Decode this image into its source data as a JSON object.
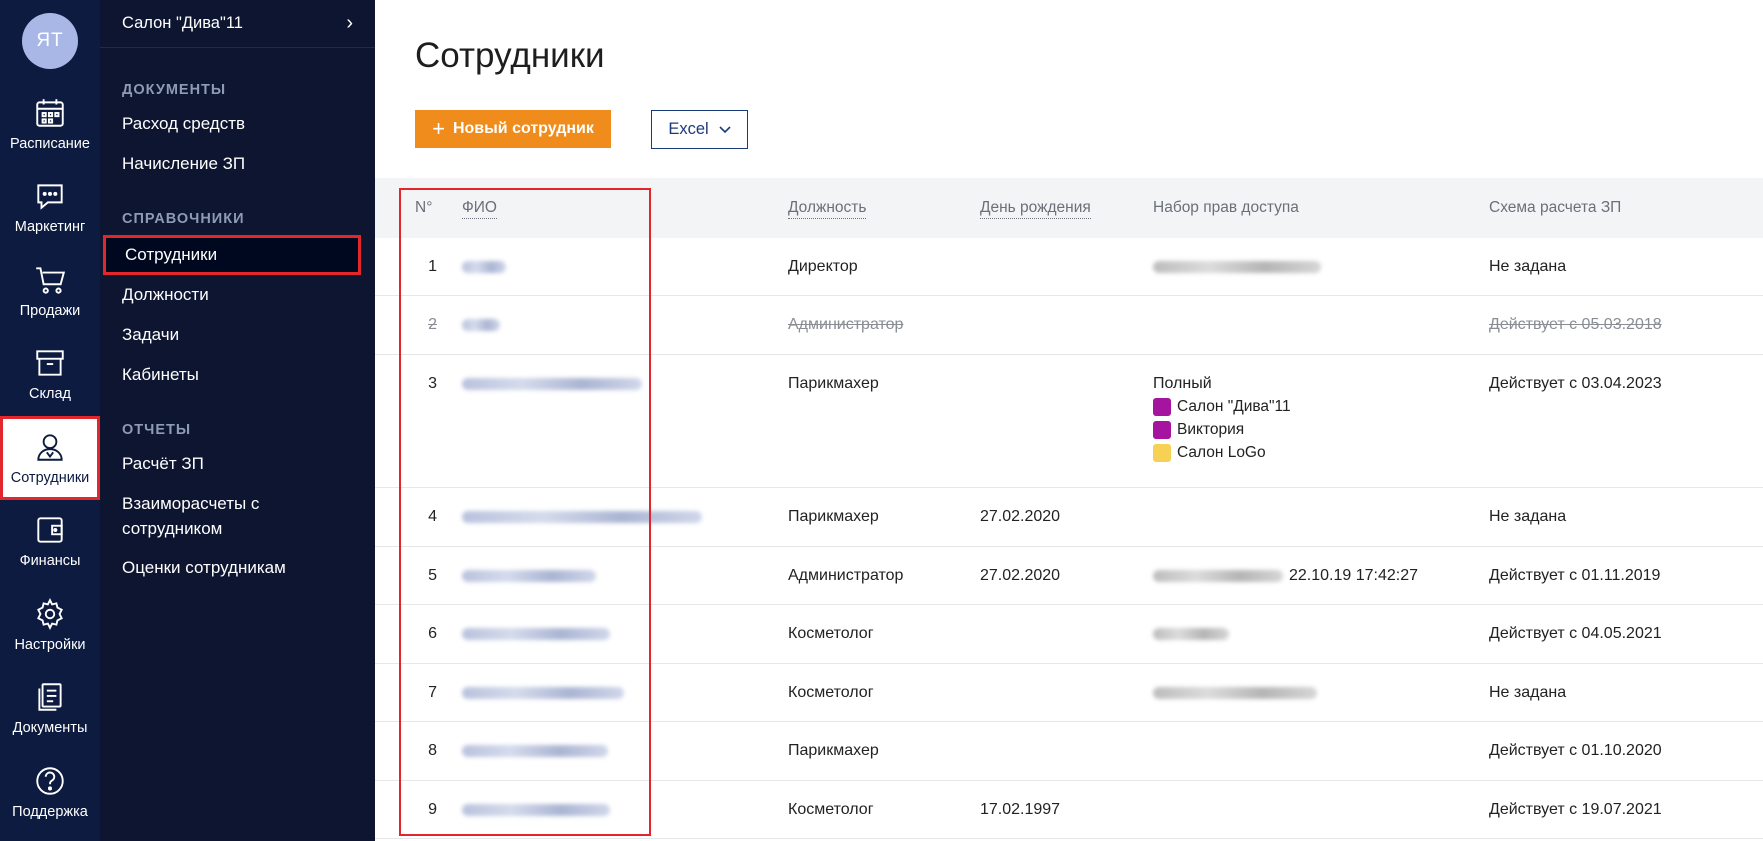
{
  "rail": {
    "avatar": "ЯТ",
    "items": [
      {
        "label": "Расписание",
        "icon": "calendar-icon"
      },
      {
        "label": "Маркетинг",
        "icon": "chat-icon"
      },
      {
        "label": "Продажи",
        "icon": "cart-icon"
      },
      {
        "label": "Склад",
        "icon": "archive-icon"
      },
      {
        "label": "Сотрудники",
        "icon": "user-icon"
      },
      {
        "label": "Финансы",
        "icon": "wallet-icon"
      },
      {
        "label": "Настройки",
        "icon": "gear-icon"
      },
      {
        "label": "Документы",
        "icon": "documents-icon"
      },
      {
        "label": "Поддержка",
        "icon": "help-icon"
      }
    ]
  },
  "menu": {
    "salon": "Салон \"Дива\"11",
    "sections": {
      "docs": "ДОКУМЕНТЫ",
      "refs": "СПРАВОЧНИКИ",
      "reports": "ОТЧЕТЫ"
    },
    "docs_items": [
      "Расход средств",
      "Начисление ЗП"
    ],
    "refs_items": [
      "Сотрудники",
      "Должности",
      "Задачи",
      "Кабинеты"
    ],
    "reports_items": [
      "Расчёт ЗП",
      "Взаиморасчеты с сотрудником",
      "Оценки сотрудникам"
    ]
  },
  "page": {
    "title": "Сотрудники",
    "new_button": "Новый сотрудник",
    "excel_button": "Excel"
  },
  "table": {
    "headers": {
      "num": "N°",
      "fio": "ФИО",
      "position": "Должность",
      "birthday": "День рождения",
      "access": "Набор прав доступа",
      "scheme": "Схема расчета ЗП"
    },
    "rows": [
      {
        "num": "1",
        "position": "Директор",
        "birthday": "",
        "access_time": "",
        "scheme": "Не задана"
      },
      {
        "num": "2",
        "position": "Администратор",
        "birthday": "",
        "access_time": "",
        "scheme": "Действует с 05.03.2018"
      },
      {
        "num": "3",
        "position": "Парикмахер",
        "birthday": "",
        "access_time": "",
        "scheme": "Действует с 03.04.2023"
      },
      {
        "num": "4",
        "position": "Парикмахер",
        "birthday": "27.02.2020",
        "access_time": "",
        "scheme": "Не задана"
      },
      {
        "num": "5",
        "position": "Администратор",
        "birthday": "27.02.2020",
        "access_time": "22.10.19 17:42:27",
        "scheme": "Действует с 01.11.2019"
      },
      {
        "num": "6",
        "position": "Косметолог",
        "birthday": "",
        "access_time": "",
        "scheme": "Действует с 04.05.2021"
      },
      {
        "num": "7",
        "position": "Косметолог",
        "birthday": "",
        "access_time": "",
        "scheme": "Не задана"
      },
      {
        "num": "8",
        "position": "Парикмахер",
        "birthday": "",
        "access_time": "",
        "scheme": "Действует с 01.10.2020"
      },
      {
        "num": "9",
        "position": "Косметолог",
        "birthday": "17.02.1997",
        "access_time": "",
        "scheme": "Действует с 19.07.2021"
      }
    ],
    "row3_access": {
      "title": "Полный",
      "salons": [
        {
          "name": "Салон \"Дива\"11",
          "color": "#a5149e"
        },
        {
          "name": "Виктория",
          "color": "#a5149e"
        },
        {
          "name": "Салон LoGo",
          "color": "#f7d154"
        }
      ]
    }
  },
  "colors": {
    "rail_bg": "#0c1b3f",
    "menu_bg": "#0d1530",
    "accent_orange": "#ef8c1b",
    "highlight_red": "#e3262b",
    "excel_blue": "#1b3b78"
  }
}
